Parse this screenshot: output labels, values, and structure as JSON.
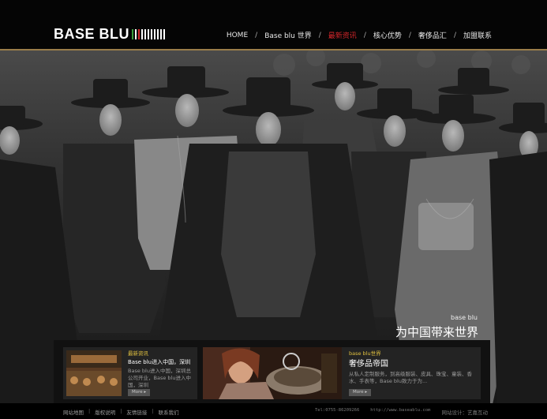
{
  "brand": {
    "logo_text": "BASE BLU"
  },
  "nav": {
    "items": [
      {
        "label": "HOME",
        "active": false
      },
      {
        "label": "Base blu 世界",
        "active": false
      },
      {
        "label": "最新资讯",
        "active": true
      },
      {
        "label": "核心优势",
        "active": false
      },
      {
        "label": "奢侈品汇",
        "active": false
      },
      {
        "label": "加盟联系",
        "active": false
      }
    ],
    "separator": "/"
  },
  "hero": {
    "caption_small": "base blu",
    "caption_big": "为中国带来世界",
    "slider": {
      "prev": "‹",
      "next": "›",
      "total": 4,
      "active_index": 2
    }
  },
  "news_cards": [
    {
      "tag": "最新资讯",
      "title": "Base blu进入中国，深圳",
      "text": "Base blu进入中国，深圳总公司开业，Base blu进入中国，深圳",
      "more": "More ▸"
    },
    {
      "tag": "base blu世界",
      "title": "奢侈品帝国",
      "text": "从私人定制服务，到高级服装、皮具、珠宝、童装、香水、手表等，Base blu致力于为...",
      "more": "More ▸"
    }
  ],
  "footer": {
    "links": [
      "网站地图",
      "版权说明",
      "友情链接",
      "联系我们"
    ],
    "separator": "|",
    "phone": "Tel:0755-86209266",
    "website": "http://www.baseablu.com",
    "design": "网站设计：艺嘉互动"
  },
  "colors": {
    "accent": "#d4262a",
    "gold": "#e0c040",
    "line": "#9a7d4a"
  }
}
